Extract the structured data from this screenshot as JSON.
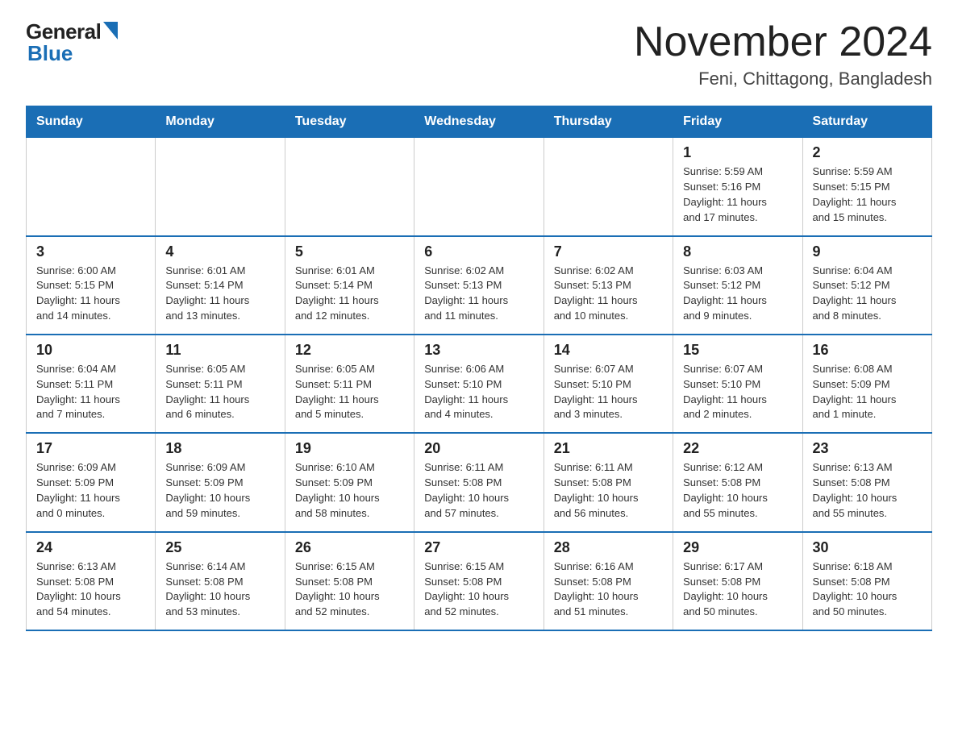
{
  "logo": {
    "general": "General",
    "blue": "Blue"
  },
  "title": "November 2024",
  "subtitle": "Feni, Chittagong, Bangladesh",
  "days_of_week": [
    "Sunday",
    "Monday",
    "Tuesday",
    "Wednesday",
    "Thursday",
    "Friday",
    "Saturday"
  ],
  "weeks": [
    [
      {
        "day": "",
        "info": ""
      },
      {
        "day": "",
        "info": ""
      },
      {
        "day": "",
        "info": ""
      },
      {
        "day": "",
        "info": ""
      },
      {
        "day": "",
        "info": ""
      },
      {
        "day": "1",
        "info": "Sunrise: 5:59 AM\nSunset: 5:16 PM\nDaylight: 11 hours\nand 17 minutes."
      },
      {
        "day": "2",
        "info": "Sunrise: 5:59 AM\nSunset: 5:15 PM\nDaylight: 11 hours\nand 15 minutes."
      }
    ],
    [
      {
        "day": "3",
        "info": "Sunrise: 6:00 AM\nSunset: 5:15 PM\nDaylight: 11 hours\nand 14 minutes."
      },
      {
        "day": "4",
        "info": "Sunrise: 6:01 AM\nSunset: 5:14 PM\nDaylight: 11 hours\nand 13 minutes."
      },
      {
        "day": "5",
        "info": "Sunrise: 6:01 AM\nSunset: 5:14 PM\nDaylight: 11 hours\nand 12 minutes."
      },
      {
        "day": "6",
        "info": "Sunrise: 6:02 AM\nSunset: 5:13 PM\nDaylight: 11 hours\nand 11 minutes."
      },
      {
        "day": "7",
        "info": "Sunrise: 6:02 AM\nSunset: 5:13 PM\nDaylight: 11 hours\nand 10 minutes."
      },
      {
        "day": "8",
        "info": "Sunrise: 6:03 AM\nSunset: 5:12 PM\nDaylight: 11 hours\nand 9 minutes."
      },
      {
        "day": "9",
        "info": "Sunrise: 6:04 AM\nSunset: 5:12 PM\nDaylight: 11 hours\nand 8 minutes."
      }
    ],
    [
      {
        "day": "10",
        "info": "Sunrise: 6:04 AM\nSunset: 5:11 PM\nDaylight: 11 hours\nand 7 minutes."
      },
      {
        "day": "11",
        "info": "Sunrise: 6:05 AM\nSunset: 5:11 PM\nDaylight: 11 hours\nand 6 minutes."
      },
      {
        "day": "12",
        "info": "Sunrise: 6:05 AM\nSunset: 5:11 PM\nDaylight: 11 hours\nand 5 minutes."
      },
      {
        "day": "13",
        "info": "Sunrise: 6:06 AM\nSunset: 5:10 PM\nDaylight: 11 hours\nand 4 minutes."
      },
      {
        "day": "14",
        "info": "Sunrise: 6:07 AM\nSunset: 5:10 PM\nDaylight: 11 hours\nand 3 minutes."
      },
      {
        "day": "15",
        "info": "Sunrise: 6:07 AM\nSunset: 5:10 PM\nDaylight: 11 hours\nand 2 minutes."
      },
      {
        "day": "16",
        "info": "Sunrise: 6:08 AM\nSunset: 5:09 PM\nDaylight: 11 hours\nand 1 minute."
      }
    ],
    [
      {
        "day": "17",
        "info": "Sunrise: 6:09 AM\nSunset: 5:09 PM\nDaylight: 11 hours\nand 0 minutes."
      },
      {
        "day": "18",
        "info": "Sunrise: 6:09 AM\nSunset: 5:09 PM\nDaylight: 10 hours\nand 59 minutes."
      },
      {
        "day": "19",
        "info": "Sunrise: 6:10 AM\nSunset: 5:09 PM\nDaylight: 10 hours\nand 58 minutes."
      },
      {
        "day": "20",
        "info": "Sunrise: 6:11 AM\nSunset: 5:08 PM\nDaylight: 10 hours\nand 57 minutes."
      },
      {
        "day": "21",
        "info": "Sunrise: 6:11 AM\nSunset: 5:08 PM\nDaylight: 10 hours\nand 56 minutes."
      },
      {
        "day": "22",
        "info": "Sunrise: 6:12 AM\nSunset: 5:08 PM\nDaylight: 10 hours\nand 55 minutes."
      },
      {
        "day": "23",
        "info": "Sunrise: 6:13 AM\nSunset: 5:08 PM\nDaylight: 10 hours\nand 55 minutes."
      }
    ],
    [
      {
        "day": "24",
        "info": "Sunrise: 6:13 AM\nSunset: 5:08 PM\nDaylight: 10 hours\nand 54 minutes."
      },
      {
        "day": "25",
        "info": "Sunrise: 6:14 AM\nSunset: 5:08 PM\nDaylight: 10 hours\nand 53 minutes."
      },
      {
        "day": "26",
        "info": "Sunrise: 6:15 AM\nSunset: 5:08 PM\nDaylight: 10 hours\nand 52 minutes."
      },
      {
        "day": "27",
        "info": "Sunrise: 6:15 AM\nSunset: 5:08 PM\nDaylight: 10 hours\nand 52 minutes."
      },
      {
        "day": "28",
        "info": "Sunrise: 6:16 AM\nSunset: 5:08 PM\nDaylight: 10 hours\nand 51 minutes."
      },
      {
        "day": "29",
        "info": "Sunrise: 6:17 AM\nSunset: 5:08 PM\nDaylight: 10 hours\nand 50 minutes."
      },
      {
        "day": "30",
        "info": "Sunrise: 6:18 AM\nSunset: 5:08 PM\nDaylight: 10 hours\nand 50 minutes."
      }
    ]
  ]
}
